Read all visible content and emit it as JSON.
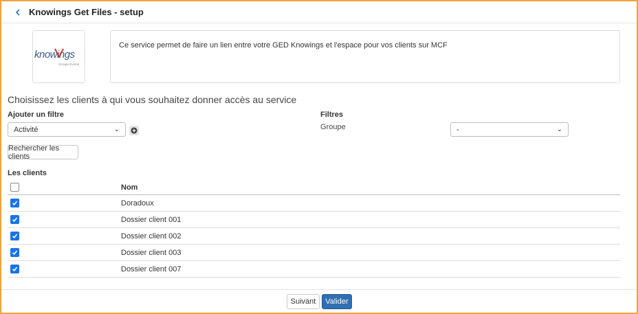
{
  "header": {
    "title": "Knowings Get Files - setup"
  },
  "service": {
    "description": "Ce service permet de faire un lien entre votre GED Knowings et l'espace pour vos clients sur MCF",
    "logo_text": "knowings",
    "logo_tagline": "Groupe Everial"
  },
  "section_title": "Choisissez les clients à qui vous souhaitez donner accès au service",
  "filters": {
    "add_filter_label": "Ajouter un filtre",
    "add_filter_value": "Activité",
    "filters_label": "Filtres",
    "group_label": "Groupe",
    "group_value": "-"
  },
  "search_button": "Rechercher les clients",
  "clients": {
    "label": "Les clients",
    "column_name": "Nom",
    "rows": [
      {
        "name": "Doradoux",
        "checked": true
      },
      {
        "name": "Dossier client 001",
        "checked": true
      },
      {
        "name": "Dossier client 002",
        "checked": true
      },
      {
        "name": "Dossier client 003",
        "checked": true
      },
      {
        "name": "Dossier client 007",
        "checked": true
      }
    ]
  },
  "footer": {
    "next_label": "Suivant",
    "validate_label": "Valider"
  },
  "colors": {
    "frame": "#f2a33a",
    "primary": "#2f6fb2",
    "checkbox": "#1a73e8"
  }
}
